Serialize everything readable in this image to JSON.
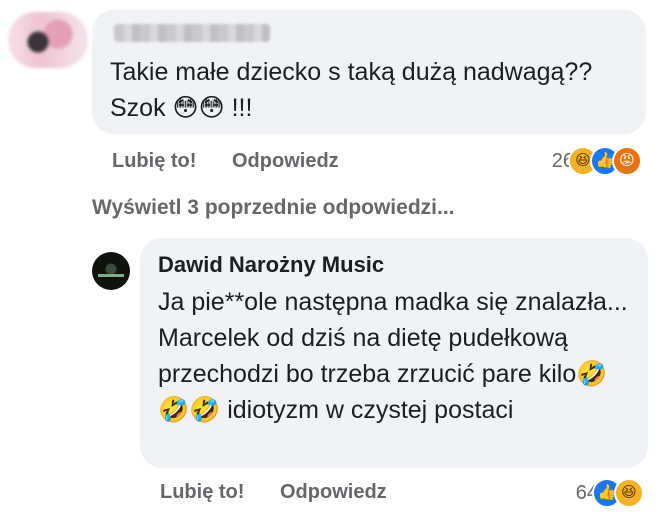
{
  "comment1": {
    "text": "Takie małe dziecko s taką dużą nadwagą?? Szok 😳😳 !!!",
    "actions": {
      "like": "Lubię to!",
      "reply": "Odpowiedz"
    },
    "reaction_count": "26",
    "reactions": [
      "haha",
      "like",
      "angry"
    ]
  },
  "more_replies": "Wyświetl 3 poprzednie odpowiedzi...",
  "comment2": {
    "author": "Dawid Narożny Music",
    "text": "Ja pie**ole następna madka się znalazła... Marcelek od dziś na dietę pudełkową przechodzi bo trzeba zrzucić pare kilo🤣🤣🤣 idiotyzm w czystej postaci",
    "actions": {
      "like": "Lubię to!",
      "reply": "Odpowiedz"
    },
    "reaction_count": "64",
    "reactions": [
      "like",
      "haha"
    ]
  },
  "icons": {
    "haha": "😆",
    "like": "👍",
    "angry": "😡"
  },
  "colors": {
    "bubble": "#f0f2f5",
    "meta": "#65676b",
    "like": "#1877f2",
    "haha": "#f7b125",
    "angry": "#e9710f"
  }
}
